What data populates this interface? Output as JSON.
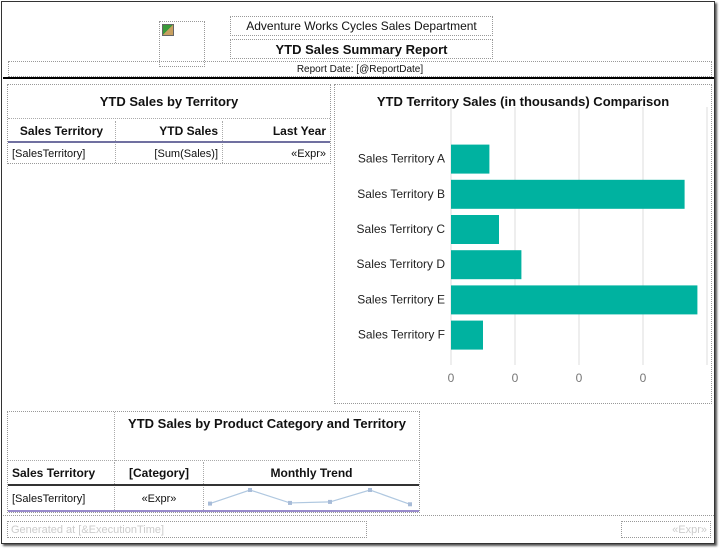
{
  "header": {
    "department": "Adventure Works Cycles Sales Department",
    "title": "YTD Sales Summary Report",
    "report_date": "Report Date: [@ReportDate]"
  },
  "table1": {
    "title": "YTD Sales by Territory",
    "headers": [
      "Sales Territory",
      "YTD Sales",
      "Last Year"
    ],
    "row": [
      "[SalesTerritory]",
      "[Sum(Sales)]",
      "«Expr»"
    ]
  },
  "chart_data": {
    "type": "bar",
    "orientation": "horizontal",
    "title": "YTD Territory Sales (in thousands) Comparison",
    "categories": [
      "Sales Territory A",
      "Sales Territory B",
      "Sales Territory C",
      "Sales Territory D",
      "Sales Territory E",
      "Sales Territory F"
    ],
    "values": [
      0.6,
      3.65,
      0.75,
      1.1,
      3.85,
      0.5
    ],
    "xlim": [
      0,
      4
    ],
    "tick_labels": [
      "0",
      "0",
      "0",
      "0"
    ],
    "color": "#00B2A0",
    "grid": true
  },
  "table2": {
    "title": "YTD Sales by Product Category and Territory",
    "headers": [
      "Sales Territory",
      "[Category]",
      "Monthly Trend"
    ],
    "row": [
      "[SalesTerritory]",
      "«Expr»"
    ],
    "sparkline": [
      1,
      5,
      1.2,
      1.5,
      5,
      0.8
    ]
  },
  "footer": {
    "generated": "Generated at [&ExecutionTime]",
    "page": "«Expr»"
  }
}
